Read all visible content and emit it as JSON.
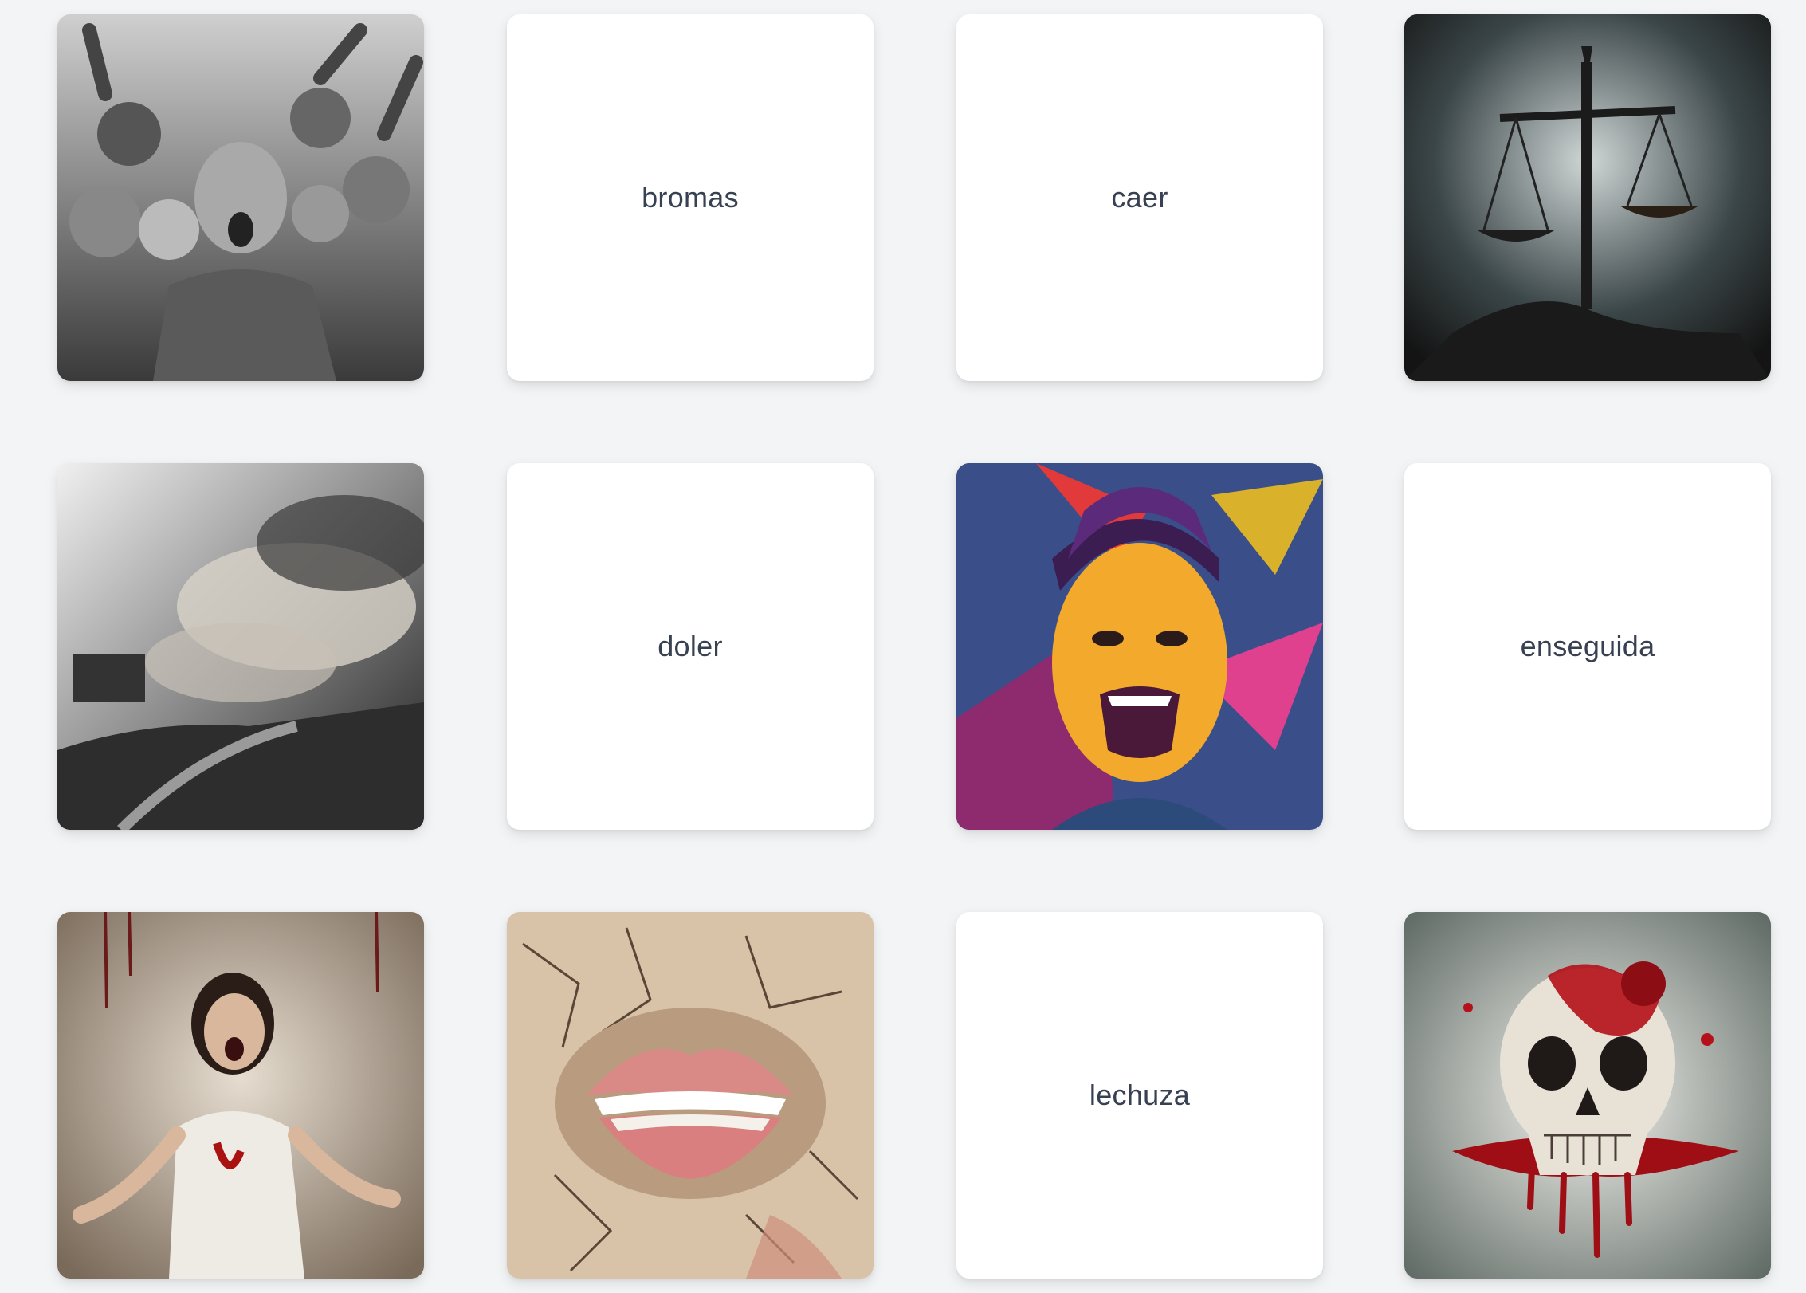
{
  "cards": [
    {
      "kind": "image",
      "icon": "crowd-screaming-image"
    },
    {
      "kind": "word",
      "text": "bromas"
    },
    {
      "kind": "word",
      "text": "caer"
    },
    {
      "kind": "image",
      "icon": "scales-storm-image"
    },
    {
      "kind": "image",
      "icon": "storm-disaster-image"
    },
    {
      "kind": "word",
      "text": "doler"
    },
    {
      "kind": "image",
      "icon": "angry-man-pop-art-image"
    },
    {
      "kind": "word",
      "text": "enseguida"
    },
    {
      "kind": "image",
      "icon": "screaming-woman-image"
    },
    {
      "kind": "image",
      "icon": "cracked-wall-lips-image"
    },
    {
      "kind": "word",
      "text": "lechuza"
    },
    {
      "kind": "image",
      "icon": "bloody-skull-image"
    }
  ],
  "colors": {
    "background": "#f3f4f6",
    "card": "#ffffff",
    "text": "#374151"
  }
}
